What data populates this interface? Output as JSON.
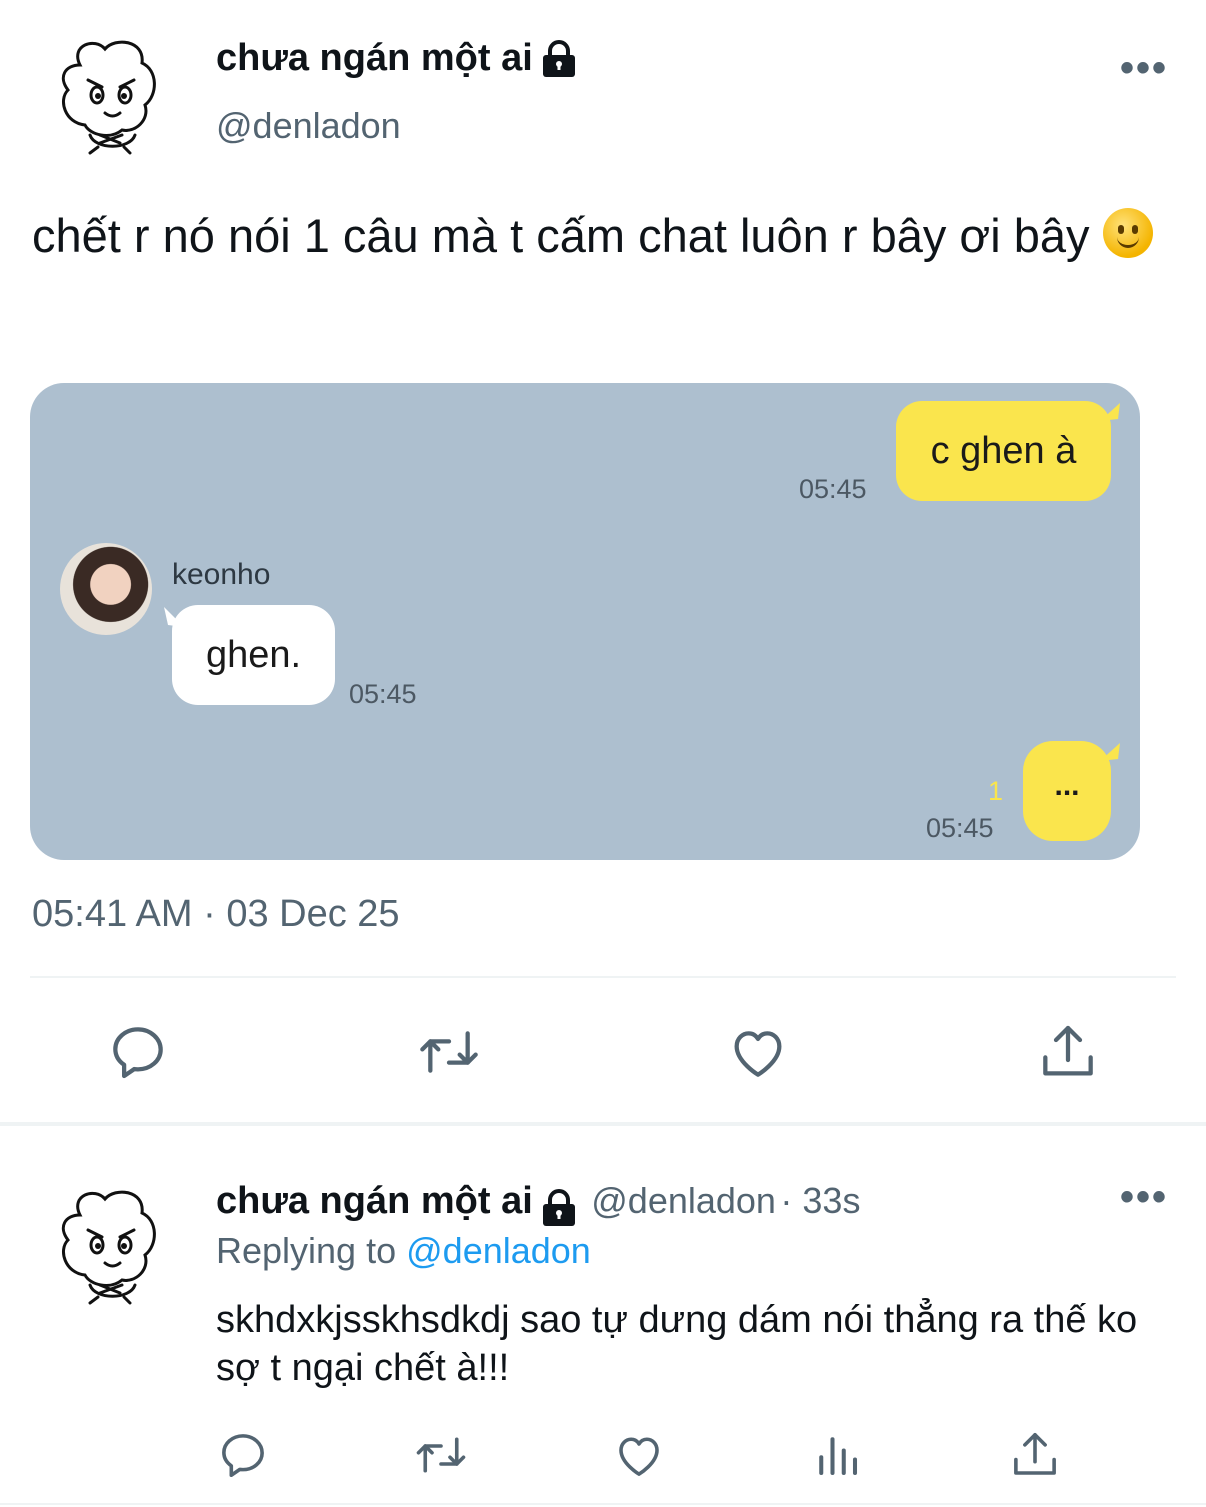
{
  "main_tweet": {
    "display_name": "chưa ngán một ai",
    "handle": "@denladon",
    "text": "chết r nó nói 1 câu mà t cấm chat luôn r bây ơi bây",
    "emoji": "slightly-smiling-face",
    "timestamp": "05:41 AM · 03 Dec 25",
    "more_label": "•••"
  },
  "chat": {
    "messages": [
      {
        "side": "right",
        "text": "c ghen à",
        "time": "05:45"
      },
      {
        "side": "left",
        "sender": "keonho",
        "text": "ghen.",
        "time": "05:45"
      },
      {
        "side": "right",
        "text": "...",
        "time": "05:45",
        "unread": "1"
      }
    ],
    "background": "#adbfcf",
    "bubble_mine": "#fae54d",
    "bubble_theirs": "#ffffff"
  },
  "reply_tweet": {
    "display_name": "chưa ngán một ai",
    "handle": "@denladon",
    "age": "· 33s",
    "replying_prefix": "Replying to",
    "replying_handle": "@denladon",
    "text": "skhdxkjsskhsdkdj sao tự dưng dám nói thẳng ra thế ko sợ t ngại chết à!!!",
    "more_label": "•••"
  },
  "icons": [
    "reply-icon",
    "retweet-icon",
    "like-icon",
    "share-icon",
    "analytics-icon",
    "lock-icon"
  ],
  "colors": {
    "secondary_text": "#536471",
    "link": "#1d9bf0",
    "text": "#0f1419"
  }
}
